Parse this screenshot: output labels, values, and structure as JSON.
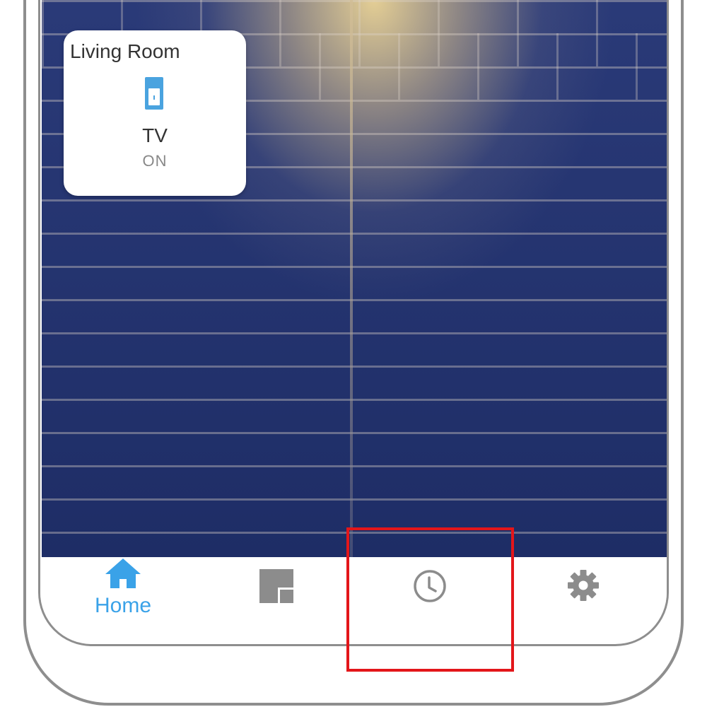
{
  "device_card": {
    "room": "Living Room",
    "device_name": "TV",
    "device_state": "ON",
    "icon": "switch-icon"
  },
  "bottom_nav": {
    "items": [
      {
        "label": "Home",
        "icon": "home-icon",
        "active": true
      },
      {
        "label": "",
        "icon": "rooms-icon",
        "active": false
      },
      {
        "label": "",
        "icon": "clock-icon",
        "active": false
      },
      {
        "label": "",
        "icon": "gear-icon",
        "active": false
      }
    ]
  },
  "colors": {
    "accent": "#3aa2e8",
    "icon_inactive": "#8c8c8c",
    "highlight": "#e3161a"
  }
}
